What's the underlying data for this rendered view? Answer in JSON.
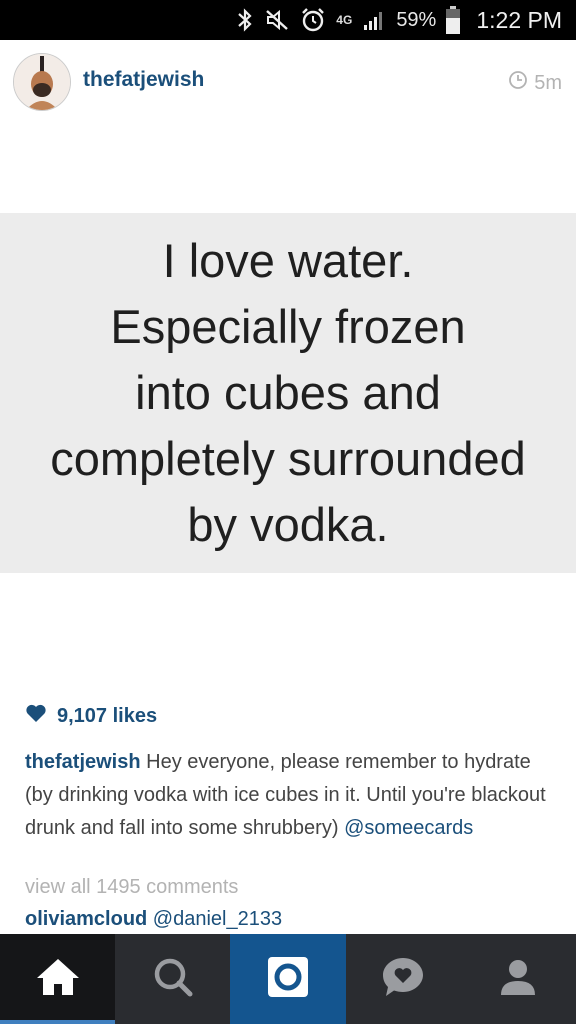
{
  "status_bar": {
    "network": "4G",
    "battery": "59%",
    "time": "1:22 PM"
  },
  "post": {
    "username": "thefatjewish",
    "time_ago": "5m",
    "image_text": [
      "I love water.",
      "Especially frozen",
      "into cubes and",
      "completely surrounded",
      "by vodka."
    ],
    "likes": "9,107 likes",
    "caption_user": "thefatjewish",
    "caption_text": " Hey everyone, please remember to hydrate (by drinking vodka with ice cubes in it. Until you're blackout drunk and fall into some shrubbery) ",
    "caption_mention": "@someecards",
    "view_all_comments": "view all 1495 comments",
    "comment_user": "oliviamcloud",
    "comment_text": " @daniel_2133"
  },
  "nav": {
    "items": [
      "home",
      "search",
      "camera",
      "activity",
      "profile"
    ],
    "active": "home"
  },
  "colors": {
    "link_blue": "#1b4f7a",
    "nav_bg": "#2a2c30",
    "camera_bg": "#14558f"
  },
  "icons": [
    "bluetooth-icon",
    "mute-icon",
    "alarm-icon",
    "signal-icon",
    "battery-icon",
    "clock-icon",
    "heart-icon",
    "home-icon",
    "search-icon",
    "camera-icon",
    "activity-icon",
    "profile-icon"
  ]
}
